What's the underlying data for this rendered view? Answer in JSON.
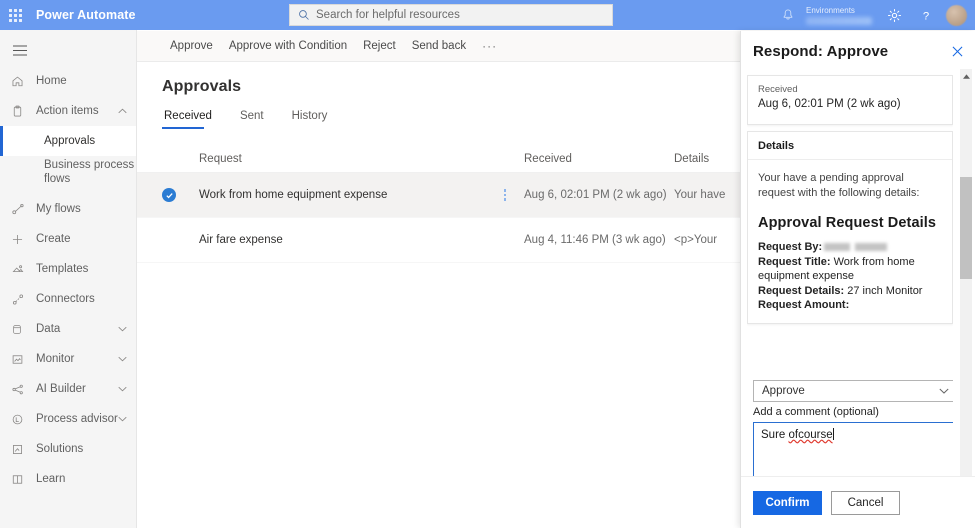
{
  "header": {
    "brand": "Power Automate",
    "waffle_icon": "app-launcher-icon",
    "search": {
      "placeholder": "Search for helpful resources",
      "value": "",
      "icon": "search-icon"
    },
    "notification_icon": "bell-icon",
    "environment_label": "Environments",
    "environment_name": "",
    "settings_icon": "gear-icon",
    "help_icon": "help-question-icon",
    "avatar": "user-avatar"
  },
  "sidebar": {
    "menu_icon": "hamburger-menu-icon",
    "items": [
      {
        "label": "Home",
        "icon": "home-icon",
        "chevron": "",
        "sub": false,
        "selected": false
      },
      {
        "label": "Action items",
        "icon": "clipboard-icon",
        "chevron": "up",
        "sub": false,
        "selected": false
      },
      {
        "label": "Approvals",
        "icon": "",
        "chevron": "",
        "sub": true,
        "selected": true
      },
      {
        "label": "Business process flows",
        "icon": "",
        "chevron": "",
        "sub": true,
        "selected": false
      },
      {
        "label": "My flows",
        "icon": "flow-icon",
        "chevron": "",
        "sub": false,
        "selected": false
      },
      {
        "label": "Create",
        "icon": "plus-icon",
        "chevron": "",
        "sub": false,
        "selected": false
      },
      {
        "label": "Templates",
        "icon": "templates-icon",
        "chevron": "",
        "sub": false,
        "selected": false
      },
      {
        "label": "Connectors",
        "icon": "connectors-icon",
        "chevron": "",
        "sub": false,
        "selected": false
      },
      {
        "label": "Data",
        "icon": "database-icon",
        "chevron": "down",
        "sub": false,
        "selected": false
      },
      {
        "label": "Monitor",
        "icon": "monitor-icon",
        "chevron": "down",
        "sub": false,
        "selected": false
      },
      {
        "label": "AI Builder",
        "icon": "ai-builder-icon",
        "chevron": "down",
        "sub": false,
        "selected": false
      },
      {
        "label": "Process advisor",
        "icon": "process-advisor-icon",
        "chevron": "down",
        "sub": false,
        "selected": false
      },
      {
        "label": "Solutions",
        "icon": "solutions-icon",
        "chevron": "",
        "sub": false,
        "selected": false
      },
      {
        "label": "Learn",
        "icon": "book-icon",
        "chevron": "",
        "sub": false,
        "selected": false
      }
    ]
  },
  "commandbar": {
    "items": [
      "Approve",
      "Approve with Condition",
      "Reject",
      "Send back"
    ],
    "overflow": "···"
  },
  "main": {
    "title": "Approvals",
    "tabs": [
      {
        "label": "Received",
        "active": true
      },
      {
        "label": "Sent",
        "active": false
      },
      {
        "label": "History",
        "active": false
      }
    ],
    "columns": [
      "Request",
      "Received",
      "Details"
    ],
    "rows": [
      {
        "request": "Work from home equipment expense",
        "received": "Aug 6, 02:01 PM (2 wk ago)",
        "details": "Your have",
        "selected": true
      },
      {
        "request": "Air fare expense",
        "received": "Aug 4, 11:46 PM (3 wk ago)",
        "details": "<p>Your",
        "selected": false
      }
    ]
  },
  "panel": {
    "title": "Respond: Approve",
    "close_icon": "close-icon",
    "received_card": {
      "label": "Received",
      "value": "Aug 6, 02:01 PM (2 wk ago)"
    },
    "details_card": {
      "header": "Details",
      "intro": "Your have a pending approval request with the following details:",
      "heading": "Approval Request Details",
      "fields": [
        {
          "key": "Request By:",
          "value": "",
          "redacted": true
        },
        {
          "key": "Request Title:",
          "value": "Work from home equipment expense",
          "redacted": false
        },
        {
          "key": "Request Details:",
          "value": "27 inch Monitor",
          "redacted": false
        },
        {
          "key": "Request Amount:",
          "value": "",
          "redacted": false
        }
      ]
    },
    "response_select": {
      "value": "Approve",
      "chevron_icon": "chevron-down-icon"
    },
    "comment": {
      "label": "Add a comment (optional)",
      "value_prefix": "Sure ",
      "value_misspelled": "ofcourse",
      "placeholder": ""
    },
    "confirm_label": "Confirm",
    "cancel_label": "Cancel",
    "scrollbar": {
      "up_icon": "scroll-up-arrow-icon",
      "down_icon": "scroll-down-arrow-icon"
    }
  },
  "colors": {
    "header_blue": "#6a9bf0",
    "accent_blue": "#1668e3",
    "selected_row": "#f3f2f1",
    "sidebar_bg": "#f5f5f5",
    "focus_border": "#2a6fd1",
    "spellcheck_red": "#e03b30"
  }
}
